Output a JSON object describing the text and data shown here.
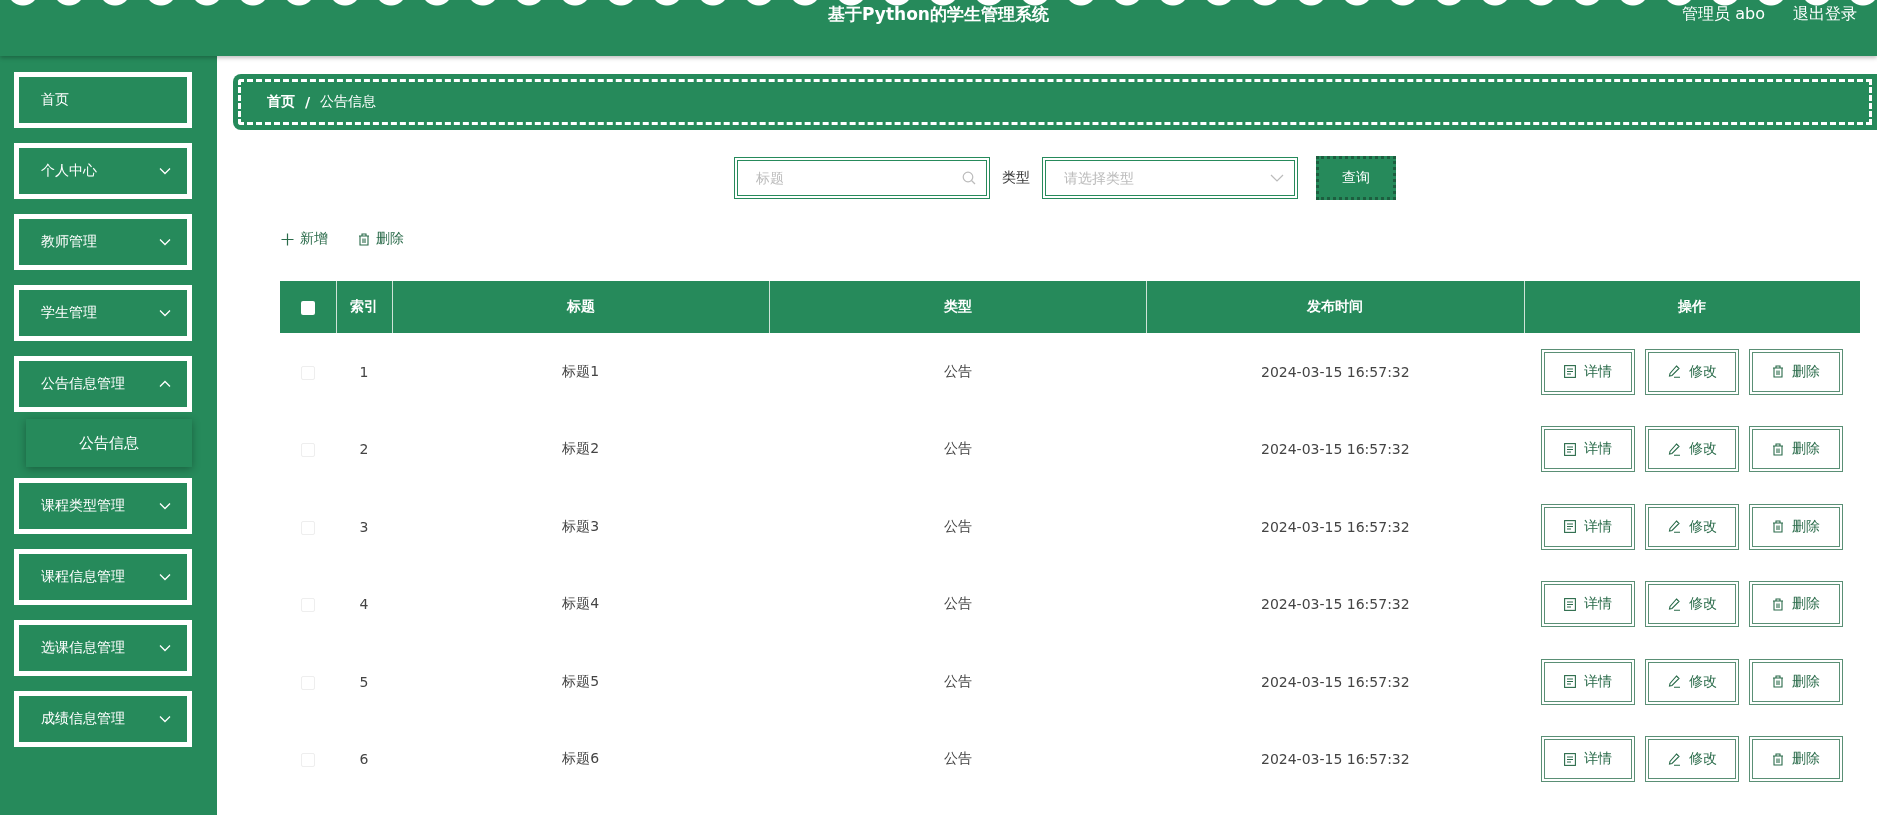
{
  "header": {
    "title": "基于Python的学生管理系统",
    "user": "管理员 abo",
    "logout": "退出登录"
  },
  "sidebar": {
    "items": [
      {
        "label": "首页",
        "kind": "link"
      },
      {
        "label": "个人中心",
        "kind": "menu",
        "expanded": false
      },
      {
        "label": "教师管理",
        "kind": "menu",
        "expanded": false
      },
      {
        "label": "学生管理",
        "kind": "menu",
        "expanded": false
      },
      {
        "label": "公告信息管理",
        "kind": "menu",
        "expanded": true,
        "children": [
          {
            "label": "公告信息",
            "selected": true
          }
        ]
      },
      {
        "label": "课程类型管理",
        "kind": "menu",
        "expanded": false
      },
      {
        "label": "课程信息管理",
        "kind": "menu",
        "expanded": false
      },
      {
        "label": "选课信息管理",
        "kind": "menu",
        "expanded": false
      },
      {
        "label": "成绩信息管理",
        "kind": "menu",
        "expanded": false
      }
    ]
  },
  "breadcrumb": {
    "items": [
      "首页",
      "公告信息"
    ],
    "separator": "/"
  },
  "search": {
    "title_placeholder": "标题",
    "type_label": "类型",
    "type_placeholder": "请选择类型",
    "button": "查询"
  },
  "toolbar": {
    "add": "新增",
    "delete": "删除"
  },
  "table": {
    "header_checked": false,
    "columns": [
      "索引",
      "标题",
      "类型",
      "发布时间",
      "操作"
    ],
    "rows": [
      {
        "index": "1",
        "title": "标题1",
        "type": "公告",
        "time": "2024-03-15 16:57:32",
        "checked": false,
        "actions": [
          "详情",
          "修改",
          "删除"
        ]
      },
      {
        "index": "2",
        "title": "标题2",
        "type": "公告",
        "time": "2024-03-15 16:57:32",
        "checked": false,
        "actions": [
          "详情",
          "修改",
          "删除"
        ]
      },
      {
        "index": "3",
        "title": "标题3",
        "type": "公告",
        "time": "2024-03-15 16:57:32",
        "checked": false,
        "actions": [
          "详情",
          "修改",
          "删除"
        ]
      },
      {
        "index": "4",
        "title": "标题4",
        "type": "公告",
        "time": "2024-03-15 16:57:32",
        "checked": false,
        "actions": [
          "详情",
          "修改",
          "删除"
        ]
      },
      {
        "index": "5",
        "title": "标题5",
        "type": "公告",
        "time": "2024-03-15 16:57:32",
        "checked": false,
        "actions": [
          "详情",
          "修改",
          "删除"
        ]
      },
      {
        "index": "6",
        "title": "标题6",
        "type": "公告",
        "time": "2024-03-15 16:57:32",
        "checked": false,
        "actions": [
          "详情",
          "修改",
          "删除"
        ]
      }
    ]
  }
}
